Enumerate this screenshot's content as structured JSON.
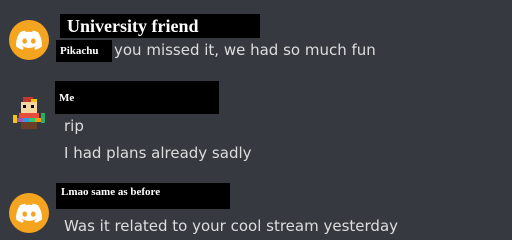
{
  "messages": [
    {
      "author": "University friend",
      "overlay_label": "Pikachu",
      "lines": [
        "you missed it, we had so much fun"
      ],
      "avatar_icon": "discord-logo-icon"
    },
    {
      "author": "Me",
      "lines": [
        "rip",
        "I had plans already sadly"
      ],
      "avatar_icon": "pixel-art-avatar-icon"
    },
    {
      "author": "Lmao same as before",
      "lines": [
        "Was it related to your cool stream yesterday"
      ],
      "avatar_icon": "discord-logo-icon"
    }
  ],
  "colors": {
    "background": "#36393f",
    "text": "#dcddde",
    "avatar_orange": "#f4a41f",
    "redaction": "#000000"
  }
}
